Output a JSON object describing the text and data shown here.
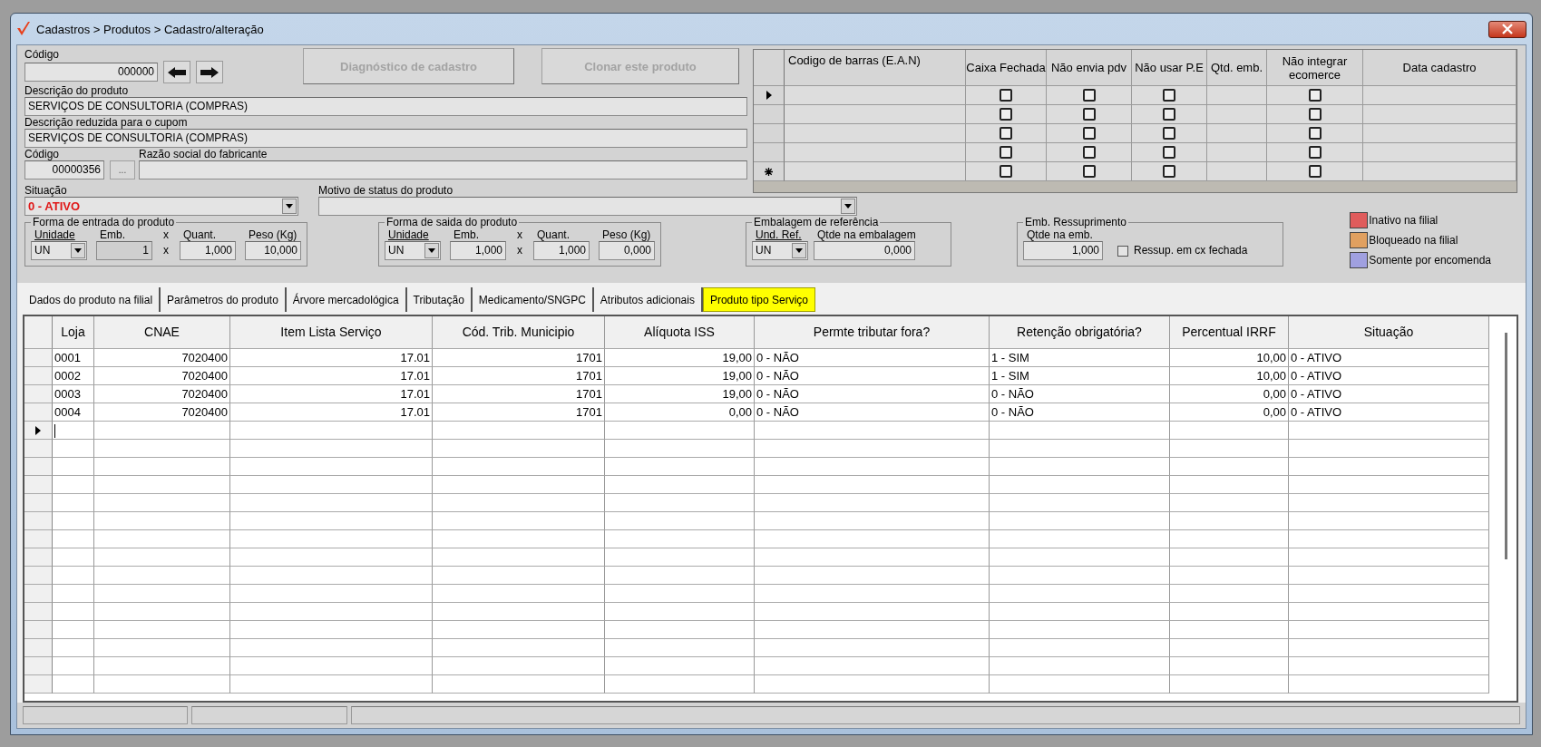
{
  "window": {
    "title": "Cadastros > Produtos > Cadastro/alteração"
  },
  "product": {
    "code": {
      "label": "Código",
      "value": "000000"
    },
    "actions": [
      {
        "label": "Diagnóstico de cadastro",
        "disabled": true
      },
      {
        "label": "Clonar este produto",
        "disabled": true
      }
    ],
    "description": {
      "label": "Descrição  do produto",
      "value": "SERVIÇOS DE CONSULTORIA (COMPRAS)"
    },
    "short_description": {
      "label": "Descrição reduzida para o cupom",
      "value": "SERVIÇOS DE CONSULTORIA (COMPRAS)"
    },
    "manufacturer_code": {
      "label": "Código",
      "value": "00000356",
      "lookup": "..."
    },
    "manufacturer_name": {
      "label": "Razão social do fabricante"
    },
    "status": {
      "label": "Situação",
      "value": "0 - ATIVO"
    },
    "status_reason": {
      "label": "Motivo de status do produto"
    }
  },
  "barcodes": {
    "columns": [
      {
        "label": "Codigo de barras (E.A.N)",
        "kind": "text"
      },
      {
        "label": "Caixa Fechada",
        "kind": "check"
      },
      {
        "label": "Não envia pdv",
        "kind": "check"
      },
      {
        "label": "Não usar P.E",
        "kind": "check"
      },
      {
        "label": "Qtd. emb.",
        "kind": "text"
      },
      {
        "label": "Não integrar ecomerce",
        "kind": "check"
      },
      {
        "label": "Data cadastro",
        "kind": "text"
      }
    ],
    "rows": [
      {
        "kind": "current",
        "checks": [
          false,
          false,
          false,
          false
        ]
      },
      {
        "kind": "plain",
        "checks": [
          false,
          false,
          false,
          false
        ]
      },
      {
        "kind": "plain",
        "checks": [
          false,
          false,
          false,
          false
        ]
      },
      {
        "kind": "plain",
        "checks": [
          false,
          false,
          false,
          false
        ]
      },
      {
        "kind": "new",
        "checks": [
          false,
          false,
          false,
          false
        ]
      }
    ]
  },
  "groups": [
    {
      "title": "Forma de entrada do produto",
      "fields": [
        {
          "kind": "select",
          "label": "Unidade",
          "value": "UN"
        },
        {
          "kind": "input",
          "label": "Emb.",
          "value": "1",
          "disabled": true
        },
        {
          "kind": "times",
          "label": "x",
          "value": "x"
        },
        {
          "kind": "input",
          "label": "Quant.",
          "value": "1,000",
          "disabled": false
        },
        {
          "kind": "input",
          "label": "Peso (Kg)",
          "value": "10,000",
          "disabled": false
        }
      ]
    },
    {
      "title": "Forma de saida do produto",
      "fields": [
        {
          "kind": "select",
          "label": "Unidade",
          "value": "UN"
        },
        {
          "kind": "input",
          "label": "Emb.",
          "value": "1,000",
          "disabled": false
        },
        {
          "kind": "times",
          "label": "x",
          "value": "x"
        },
        {
          "kind": "input",
          "label": "Quant.",
          "value": "1,000",
          "disabled": false
        },
        {
          "kind": "input",
          "label": "Peso (Kg)",
          "value": "0,000",
          "disabled": false
        }
      ]
    },
    {
      "title": "Embalagem de referência",
      "fields": [
        {
          "kind": "select",
          "label": "Und. Ref.",
          "value": "UN"
        },
        {
          "kind": "input",
          "label": "Qtde na embalagem",
          "value": "0,000",
          "disabled": false
        }
      ]
    },
    {
      "title": "Emb. Ressuprimento",
      "fields": [
        {
          "kind": "input",
          "label": "Qtde na emb.",
          "value": "1,000",
          "disabled": false
        },
        {
          "kind": "checkbox",
          "label": "Ressup. em cx fechada",
          "checked": false
        }
      ]
    }
  ],
  "legend": [
    {
      "label": "Inativo na filial",
      "color": "#e05c5c"
    },
    {
      "label": "Bloqueado na filial",
      "color": "#e0a060"
    },
    {
      "label": "Somente por encomenda",
      "color": "#a0a0e0"
    }
  ],
  "tabs": [
    {
      "label": "Dados do produto na filial",
      "selected": false
    },
    {
      "label": "Parâmetros do produto",
      "selected": false
    },
    {
      "label": "Árvore mercadológica",
      "selected": false
    },
    {
      "label": "Tributação",
      "selected": false
    },
    {
      "label": "Medicamento/SNGPC",
      "selected": false
    },
    {
      "label": "Atributos adicionais",
      "selected": false
    },
    {
      "label": "Produto tipo Serviço",
      "selected": true
    }
  ],
  "services": {
    "columns": [
      {
        "label": "Loja",
        "kind": "text"
      },
      {
        "label": "CNAE",
        "kind": "number"
      },
      {
        "label": "Item Lista Serviço",
        "kind": "number"
      },
      {
        "label": "Cód. Trib. Municipio",
        "kind": "number"
      },
      {
        "label": "Alíquota ISS",
        "kind": "number"
      },
      {
        "label": "Permte tributar fora?",
        "kind": "text"
      },
      {
        "label": "Retenção obrigatória?",
        "kind": "text"
      },
      {
        "label": "Percentual IRRF",
        "kind": "number"
      },
      {
        "label": "Situação",
        "kind": "text"
      }
    ],
    "rows": [
      {
        "current": false,
        "cells": [
          "0001",
          "7020400",
          "17.01",
          "1701",
          "19,00",
          "0 - NÃO",
          "1 - SIM",
          "10,00",
          "0 - ATIVO"
        ]
      },
      {
        "current": false,
        "cells": [
          "0002",
          "7020400",
          "17.01",
          "1701",
          "19,00",
          "0 - NÃO",
          "1 - SIM",
          "10,00",
          "0 - ATIVO"
        ]
      },
      {
        "current": false,
        "cells": [
          "0003",
          "7020400",
          "17.01",
          "1701",
          "19,00",
          "0 - NÃO",
          "0 - NÃO",
          "0,00",
          "0 - ATIVO"
        ]
      },
      {
        "current": false,
        "cells": [
          "0004",
          "7020400",
          "17.01",
          "1701",
          "0,00",
          "0 - NÃO",
          "0 - NÃO",
          "0,00",
          "0 - ATIVO"
        ]
      }
    ],
    "new_row": {
      "current": true
    }
  }
}
